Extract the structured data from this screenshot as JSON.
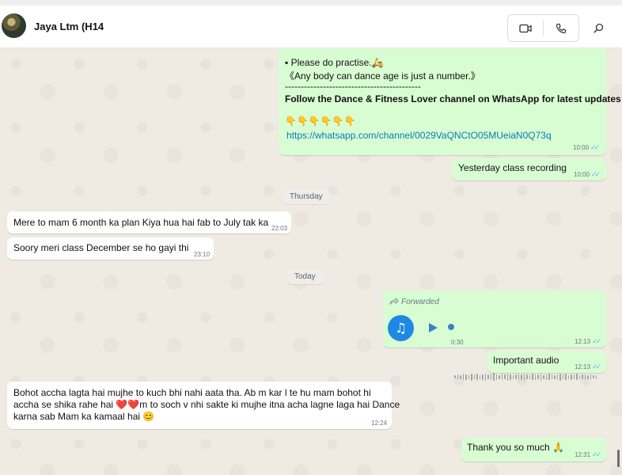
{
  "header": {
    "contact_name": "Jaya Ltm (H14",
    "video_call_icon": "video-camera-icon",
    "voice_call_icon": "phone-icon",
    "search_icon": "search-icon"
  },
  "messages": {
    "m1": {
      "partial_line": "",
      "bullet_text": "▪ Please do practise.🛵",
      "quote_text": "《Any body can dance age is just a number.》",
      "separator": "-------------------------------------------",
      "channel_text": "Follow the Dance & Fitness Lover channel on WhatsApp for latest updates:",
      "emojis": "👇👇👇👇👇👇",
      "link": "https://whatsapp.com/channel/0029VaQNCtO05MUeiaN0Q73q",
      "time": "10:00"
    },
    "m2": {
      "text": "Yesterday class recording",
      "time": "10:00"
    },
    "date1": "Thursday",
    "m3": {
      "text": "Mere to mam 6 month ka plan Kiya hua hai fab to July tak ka",
      "time": "22:03"
    },
    "m4": {
      "text": "Soory meri class December se ho gayi thi",
      "time": "23:10"
    },
    "date2": "Today",
    "m5": {
      "forwarded": "Forwarded",
      "duration": "0:30",
      "time": "12:13",
      "icon": "music-note-icon",
      "play_icon": "play-icon",
      "progress": 0
    },
    "m6": {
      "text": "Important audio",
      "time": "12:13"
    },
    "m7": {
      "line1": "Bohot accha lagta hai mujhe to kuch bhi nahi aata tha. Ab m kar l te hu mam bohot hi",
      "line2": "accha se shika rahe hai ❤️❤️m to soch v nhi sakte ki mujhe  itna acha lagne laga hai Dance",
      "line3": "karna sab Mam ka kamaal hai 😊",
      "time": "12:24"
    },
    "m8": {
      "text": "Thank you so much 🙏",
      "time": "12:31"
    }
  },
  "colors": {
    "outgoing": "#d9fdd3",
    "incoming": "#ffffff",
    "read_ticks": "#53bdeb",
    "audio_button": "#1e88e5"
  }
}
